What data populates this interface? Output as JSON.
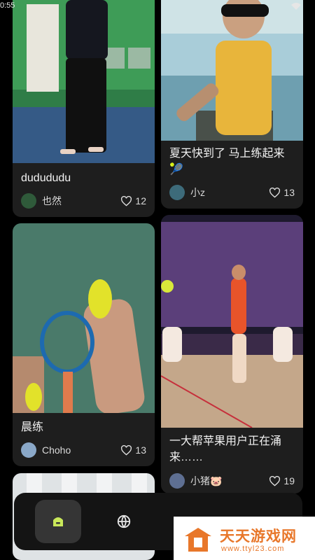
{
  "status": {
    "time": "0:55"
  },
  "feed": {
    "posts": [
      {
        "title": "dudududu",
        "author": "也然",
        "likes": "12"
      },
      {
        "title": "夏天快到了 马上练起来🎾",
        "author": "小z",
        "likes": "13"
      },
      {
        "title": "晨练",
        "author": "Choho",
        "likes": "13"
      },
      {
        "title": "一大帮苹果用户正在涌来……",
        "author": "小猪🐷",
        "likes": "19"
      }
    ]
  },
  "nav": {
    "items": [
      {
        "icon": "home-icon",
        "active": true
      },
      {
        "icon": "globe-icon",
        "active": false
      }
    ]
  },
  "watermark": {
    "title": "天天游戏网",
    "url": "www.ttyl23.com"
  },
  "colors": {
    "background": "#000000",
    "card": "#1e1e1e",
    "accent": "#c9e85a",
    "watermark": "#e8772a"
  }
}
